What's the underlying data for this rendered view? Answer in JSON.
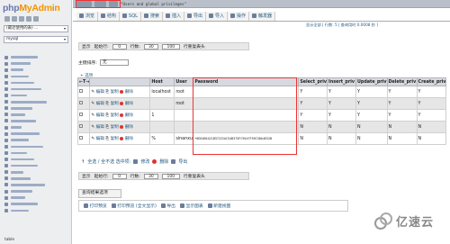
{
  "logo": {
    "part1": "php",
    "part2": "MyAdmin"
  },
  "left": {
    "recent_combo": "(最近使用的表) ...",
    "db_combo": "mysql",
    "filter_label": "(最近使用的表)",
    "db_count": 27,
    "bottom_label": "table"
  },
  "topbar": {
    "crumbs": [
      "localhost",
      "mysql",
      "user"
    ],
    "query_text": "\"Users and global privileges\""
  },
  "tabs": [
    {
      "label": "浏览",
      "icon": "browse-icon"
    },
    {
      "label": "结构",
      "icon": "structure-icon"
    },
    {
      "label": "SQL",
      "icon": "sql-icon"
    },
    {
      "label": "搜索",
      "icon": "search-icon"
    },
    {
      "label": "插入",
      "icon": "insert-icon"
    },
    {
      "label": "导出",
      "icon": "export-icon"
    },
    {
      "label": "导入",
      "icon": "import-icon"
    },
    {
      "label": "操作",
      "icon": "operations-icon"
    },
    {
      "label": "触发器",
      "icon": "triggers-icon"
    }
  ],
  "subline": "显示全部 | 行数: 5 | 查询用时 0.0008 秒 ]",
  "nav_top": {
    "show_all": "显示",
    "start_label": "起始行:",
    "start_value": "0",
    "rows_label": "行数:",
    "rows_value": "30",
    "header_label": "行重复表头",
    "header_value": "100"
  },
  "sort": {
    "label": "主键排序:",
    "value": "无"
  },
  "options_label": "+ 选项",
  "columns": [
    "←T→",
    "",
    "Host",
    "User",
    "Password",
    "Select_priv",
    "Insert_priv",
    "Update_priv",
    "Delete_priv",
    "Create_priv"
  ],
  "row_actions": {
    "edit": "编辑",
    "copy": "复制",
    "delete": "删除"
  },
  "rows": [
    {
      "host": "localhost",
      "user": "root",
      "password": "",
      "privs": [
        "Y",
        "Y",
        "Y",
        "Y",
        "Y"
      ]
    },
    {
      "host": "",
      "user": "root",
      "password": "",
      "privs": [
        "Y",
        "Y",
        "Y",
        "Y",
        "Y"
      ]
    },
    {
      "host": "1",
      "user": "",
      "password": "",
      "privs": [
        "Y",
        "Y",
        "Y",
        "Y",
        "Y"
      ]
    },
    {
      "host": "",
      "user": "",
      "password": "",
      "privs": [
        "N",
        "N",
        "N",
        "N",
        "N"
      ]
    },
    {
      "host": "%",
      "user": "sinanxu",
      "password": "*0E64B5421B37222AC54B375FC9547F59C30A4E52B",
      "privs": [
        "N",
        "N",
        "N",
        "N",
        "N"
      ]
    }
  ],
  "bulk": {
    "select_all": "全选 / 全不选  选中项:",
    "edit": "修改",
    "delete": "删除",
    "export": "导出"
  },
  "nav_bottom": {
    "show_all": "显示",
    "start_label": "起始行:",
    "start_value": "0",
    "rows_label": "行数:",
    "rows_value": "30",
    "header_label": "行重复表头",
    "header_value": "100"
  },
  "query_results_ops": "查询结果选项",
  "qr_items": [
    {
      "label": "打印预览",
      "icon": "print-icon"
    },
    {
      "label": "打印预览 (全文显示)",
      "icon": "print-full-icon"
    },
    {
      "label": "导出",
      "icon": "export-icon"
    },
    {
      "label": "显示图表",
      "icon": "chart-icon"
    },
    {
      "label": "新建视图",
      "icon": "view-icon"
    }
  ],
  "watermark": "亿速云",
  "colors": {
    "link": "#235a81",
    "highlight": "#e33333",
    "brand_orange": "#f29400",
    "brand_blue": "#6c78af"
  }
}
